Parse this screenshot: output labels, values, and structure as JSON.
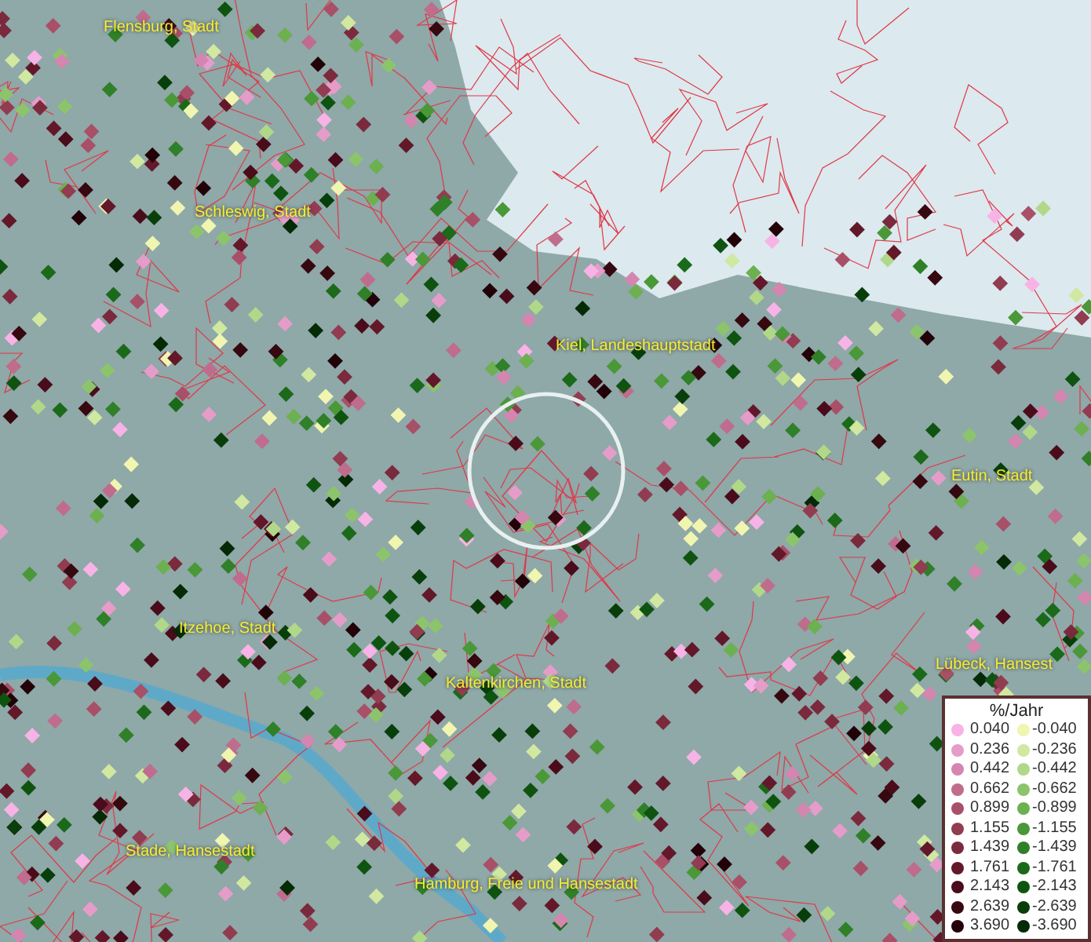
{
  "map": {
    "places": [
      {
        "name": "Flensburg, Stadt"
      },
      {
        "name": "Schleswig, Stadt"
      },
      {
        "name": "Kiel, Landeshauptstadt"
      },
      {
        "name": "Eutin, Stadt"
      },
      {
        "name": "Itzehoe, Stadt"
      },
      {
        "name": "Lübeck, Hansest"
      },
      {
        "name": "Kaltenkirchen, Stadt"
      },
      {
        "name": "Stade, Hansestadt"
      },
      {
        "name": "Hamburg, Freie und Hansestadt"
      }
    ]
  },
  "legend": {
    "title": "%/Jahr",
    "classes": [
      {
        "positive": {
          "label": "0.040",
          "color": "#f7b3e6"
        },
        "negative": {
          "label": "-0.040",
          "color": "#f0f5b0"
        }
      },
      {
        "positive": {
          "label": "0.236",
          "color": "#e59cc9"
        },
        "negative": {
          "label": "-0.236",
          "color": "#d0e8a0"
        }
      },
      {
        "positive": {
          "label": "0.442",
          "color": "#d486b0"
        },
        "negative": {
          "label": "-0.442",
          "color": "#b0d888"
        }
      },
      {
        "positive": {
          "label": "0.662",
          "color": "#bf6c8d"
        },
        "negative": {
          "label": "-0.662",
          "color": "#8cc46c"
        }
      },
      {
        "positive": {
          "label": "0.899",
          "color": "#a85068"
        },
        "negative": {
          "label": "-0.899",
          "color": "#6cb050"
        }
      },
      {
        "positive": {
          "label": "1.155",
          "color": "#913c50"
        },
        "negative": {
          "label": "-1.155",
          "color": "#4a9838"
        }
      },
      {
        "positive": {
          "label": "1.439",
          "color": "#7a2a3c"
        },
        "negative": {
          "label": "-1.439",
          "color": "#2f8028"
        }
      },
      {
        "positive": {
          "label": "1.761",
          "color": "#63182a"
        },
        "negative": {
          "label": "-1.761",
          "color": "#1a6a1a"
        }
      },
      {
        "positive": {
          "label": "2.143",
          "color": "#4a0c1a"
        },
        "negative": {
          "label": "-2.143",
          "color": "#0e5410"
        }
      },
      {
        "positive": {
          "label": "2.639",
          "color": "#360810"
        },
        "negative": {
          "label": "-2.639",
          "color": "#083e0a"
        }
      },
      {
        "positive": {
          "label": "3.690",
          "color": "#220208"
        },
        "negative": {
          "label": "-3.690",
          "color": "#042a06"
        }
      }
    ]
  }
}
